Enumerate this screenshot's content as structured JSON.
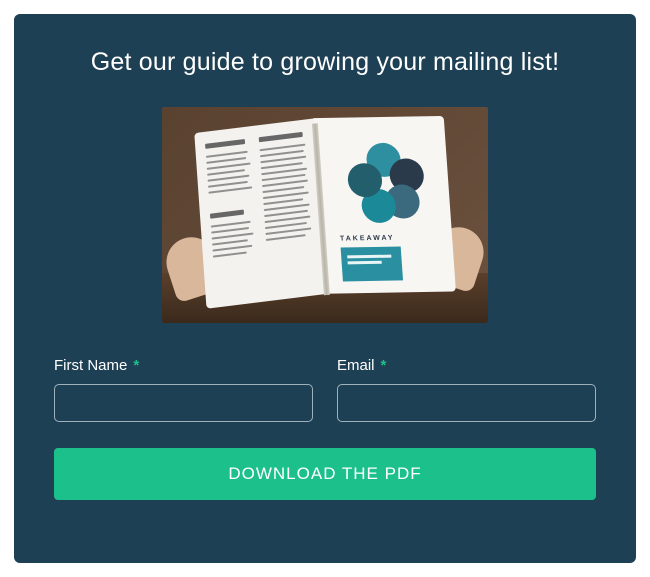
{
  "heading": "Get our guide to growing your mailing list!",
  "hero": {
    "takeaway_label": "TAKEAWAY"
  },
  "form": {
    "first_name": {
      "label": "First Name",
      "required_mark": "*",
      "value": ""
    },
    "email": {
      "label": "Email",
      "required_mark": "*",
      "value": ""
    },
    "submit_label": "DOWNLOAD THE PDF"
  },
  "colors": {
    "card_bg": "#1e4055",
    "accent": "#1cc08b"
  }
}
